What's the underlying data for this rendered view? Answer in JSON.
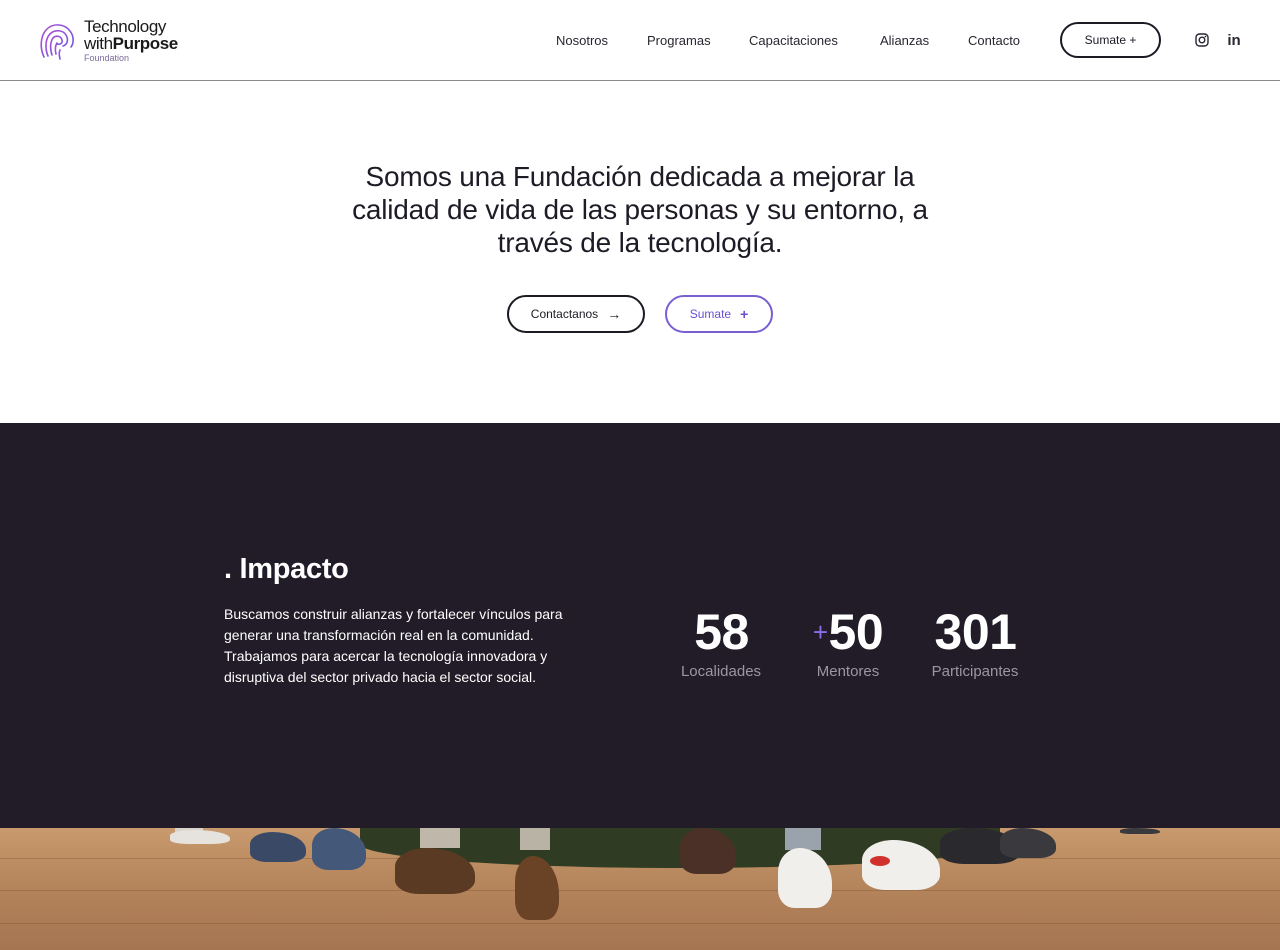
{
  "header": {
    "logo": {
      "line1": "Technology",
      "line2_prefix": "with",
      "line2_strong": "Purpose",
      "line3": "Foundation"
    },
    "nav": [
      {
        "label": "Nosotros"
      },
      {
        "label": "Programas"
      },
      {
        "label": "Capacitaciones"
      },
      {
        "label": "Alianzas"
      },
      {
        "label": "Contacto"
      }
    ],
    "cta_label": "Sumate +",
    "social": [
      "instagram-icon",
      "linkedin-icon"
    ],
    "linkedin_glyph": "in"
  },
  "hero": {
    "title": "Somos una Fundación dedicada a mejorar la calidad de vida de las personas y su entorno, a través de la tecnología.",
    "contact_button": "Contactanos",
    "contact_icon": "→",
    "join_button": "Sumate",
    "join_icon": "+"
  },
  "impact": {
    "title": ". Impacto",
    "text": "Buscamos construir alianzas y fortalecer vínculos para generar una transformación real en la comunidad. Trabajamos para acercar la tecnología innovadora y disruptiva del sector privado hacia el sector social.",
    "stats": [
      {
        "prefix": "",
        "value": "58",
        "label": "Localidades"
      },
      {
        "prefix": "+",
        "value": "50",
        "label": "Mentores"
      },
      {
        "prefix": "",
        "value": "301",
        "label": "Participantes"
      }
    ]
  },
  "colors": {
    "accent": "#7a5fd3",
    "dark_section": "#211c27",
    "muted_label": "#9b95a6"
  }
}
